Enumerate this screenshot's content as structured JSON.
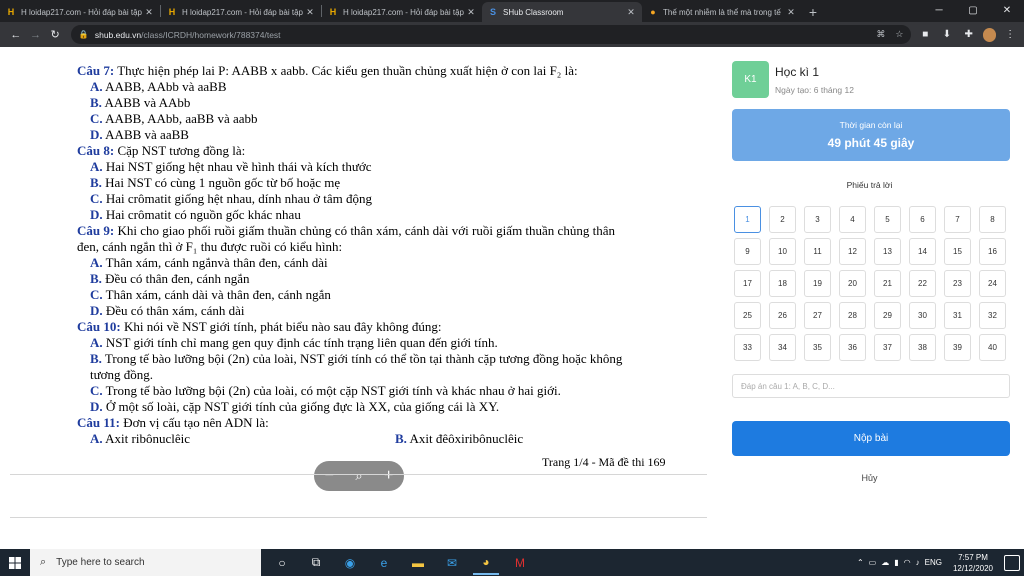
{
  "browser": {
    "tabs": [
      {
        "title": "H loidap217.com - Hỏi đáp bài tập",
        "icon": "loidap-favicon",
        "active": false
      },
      {
        "title": "H loidap217.com - Hỏi đáp bài tập",
        "icon": "loidap-favicon",
        "active": false
      },
      {
        "title": "H loidap217.com - Hỏi đáp bài tập",
        "icon": "loidap-favicon",
        "active": false
      },
      {
        "title": "SHub Classroom",
        "icon": "shub-favicon",
        "active": true
      },
      {
        "title": "Thế một nhiễm là thể mà trong tế",
        "icon": "orange-favicon",
        "active": false
      }
    ],
    "new_tab": "+",
    "url_host": "shub.edu.vn",
    "url_path": "/class/ICRDH/homework/788374/test"
  },
  "document": {
    "questions": [
      {
        "num": "Câu 7:",
        "text": " Thực hiện phép lai P: AABB x aabb. Các kiểu gen thuần chủng xuất hiện ở con lai F₂ là:",
        "options": [
          {
            "letter": "A.",
            "text": " AABB, AAbb và aaBB"
          },
          {
            "letter": "B.",
            "text": " AABB và AAbb"
          },
          {
            "letter": "C.",
            "text": " AABB, AAbb, aaBB và aabb"
          },
          {
            "letter": "D.",
            "text": " AABB và aaBB"
          }
        ]
      },
      {
        "num": "Câu 8:",
        "text": " Cặp NST tương đồng là:",
        "options": [
          {
            "letter": "A.",
            "text": " Hai NST giống hệt nhau về hình thái và kích thước"
          },
          {
            "letter": "B.",
            "text": " Hai NST có cùng 1 nguồn gốc từ bố hoặc mẹ"
          },
          {
            "letter": "C.",
            "text": " Hai crômatit giống hệt nhau, dính nhau ở tâm động"
          },
          {
            "letter": "D.",
            "text": " Hai crômatit có nguồn gốc khác nhau"
          }
        ]
      },
      {
        "num": "Câu 9:",
        "text": " Khi cho giao phối ruồi giấm thuần chủng có thân xám, cánh dài với ruồi giấm thuần chủng thân",
        "text2": "đen, cánh ngắn  thì ở F₁ thu được ruồi có kiểu hình:",
        "options": [
          {
            "letter": "A.",
            "text": " Thân xám, cánh ngắnvà thân đen, cánh dài"
          },
          {
            "letter": "B.",
            "text": " Đều có thân đen, cánh ngắn"
          },
          {
            "letter": "C.",
            "text": " Thân xám, cánh dài và thân đen, cánh ngắn"
          },
          {
            "letter": "D.",
            "text": " Đều có thân xám, cánh dài"
          }
        ]
      },
      {
        "num": "Câu 10:",
        "text": " Khi nói về NST giới tính, phát biểu nào sau đây không đúng:",
        "options": [
          {
            "letter": "A.",
            "text": " NST giới tính chỉ mang gen quy định các tính trạng liên quan đến giới tính."
          },
          {
            "letter": "B.",
            "text": " Trong tế bào lưỡng bội (2n) của loài, NST giới tính có thể tồn tại thành cặp tương đồng hoặc không",
            "text2": "tương đồng."
          },
          {
            "letter": "C.",
            "text": " Trong tế bào lưỡng bội (2n) của loài, có một cặp NST giới tính và khác nhau ở hai giới."
          },
          {
            "letter": "D.",
            "text": " Ở một số loài, cặp NST giới tính của giống đực là XX, của giống cái là XY."
          }
        ]
      },
      {
        "num": "Câu 11:",
        "text": " Đơn vị cấu tạo nên ADN là:",
        "options": [
          {
            "letter": "A.",
            "text": " Axit ribônuclêic"
          },
          {
            "letter": "B.",
            "text": " Axit đêôxiribônuclêic"
          }
        ]
      }
    ],
    "page_footer": "Trang 1/4 - Mã đề thi 169",
    "zoom": {
      "minus": "−",
      "plus": "+"
    }
  },
  "panel": {
    "badge": "K1",
    "title": "Học kì 1",
    "created": "Ngày tạo: 6 tháng 12",
    "time_label": "Thời gian còn lại",
    "time_value": "49 phút 45 giây",
    "sheet_title": "Phiếu trả lời",
    "answer_numbers": [
      "1",
      "2",
      "3",
      "4",
      "5",
      "6",
      "7",
      "8",
      "9",
      "10",
      "11",
      "12",
      "13",
      "14",
      "15",
      "16",
      "17",
      "18",
      "19",
      "20",
      "21",
      "22",
      "23",
      "24",
      "25",
      "26",
      "27",
      "28",
      "29",
      "30",
      "31",
      "32",
      "33",
      "34",
      "35",
      "36",
      "37",
      "38",
      "39",
      "40"
    ],
    "selected": "1",
    "answer_placeholder": "Đáp án câu 1: A, B, C, D...",
    "submit_label": "Nộp bài",
    "cancel_label": "Hủy",
    "colors": {
      "badge": "#6fcf97",
      "timer": "#6ea8e6",
      "submit": "#1e7be0"
    }
  },
  "taskbar": {
    "search_placeholder": "Type here to search",
    "lang": "ENG",
    "time": "7:57 PM",
    "date": "12/12/2020"
  }
}
